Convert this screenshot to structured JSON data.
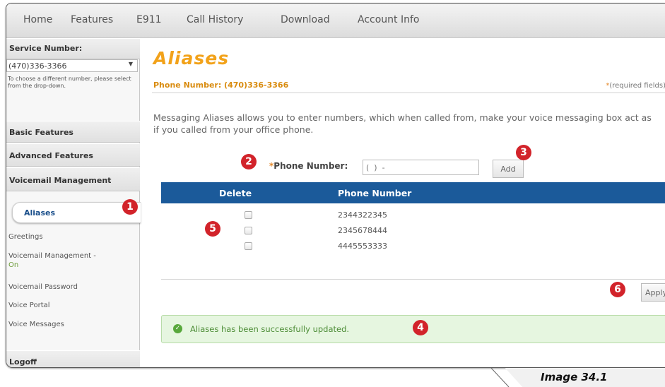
{
  "nav": [
    "Home",
    "Features",
    "E911",
    "Call History",
    "Download",
    "Account Info"
  ],
  "sidebar": {
    "service_number_label": "Service Number:",
    "service_number_value": "(470)336-3366",
    "hint": "To choose a different number, please select from the drop-down.",
    "sections": [
      "Basic Features",
      "Advanced Features",
      "Voicemail Management"
    ],
    "active_item": "Aliases",
    "links": [
      "Greetings",
      "Voicemail Management -",
      "Voicemail Password",
      "Voice Portal",
      "Voice Messages"
    ],
    "vm_status": "On",
    "logoff": "Logoff"
  },
  "page": {
    "title": "Aliases",
    "phone_number": "Phone Number: (470)336-3366",
    "required_note": "(required fields)",
    "description": "Messaging Aliases allows you to enter numbers, which when called from, make your voice messaging box act as if you called from your office phone."
  },
  "form": {
    "phone_label": "Phone Number:",
    "phone_placeholder": "(  )  -",
    "add_label": "Add"
  },
  "table": {
    "col_delete": "Delete",
    "col_phone": "Phone Number",
    "rows": [
      "2344322345",
      "2345678444",
      "4445553333"
    ]
  },
  "apply_label": "Apply",
  "success_message": "Aliases has been successfully updated.",
  "markers": [
    "1",
    "2",
    "3",
    "4",
    "5",
    "6"
  ],
  "caption": "Image 34.1",
  "colors": {
    "accent": "#f2a21a",
    "table_header": "#1b5a9a",
    "marker": "#d2232a",
    "success": "#58a83c"
  }
}
